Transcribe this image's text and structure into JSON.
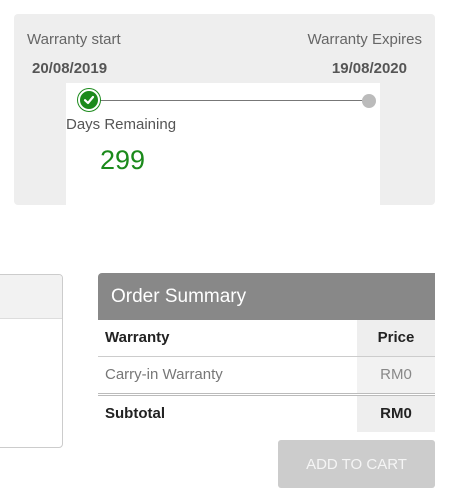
{
  "warranty": {
    "start_label": "Warranty start",
    "start_date": "20/08/2019",
    "expires_label": "Warranty Expires",
    "expires_date": "19/08/2020",
    "days_remaining_label": "Days Remaining",
    "days_remaining_value": "299",
    "accent_color": "#1b8a1b"
  },
  "order_summary": {
    "title": "Order Summary",
    "columns": [
      "Warranty",
      "Price"
    ],
    "rows": [
      {
        "name": "Carry-in Warranty",
        "price": "RM0"
      }
    ],
    "subtotal_label": "Subtotal",
    "subtotal_value": "RM0"
  },
  "actions": {
    "add_to_cart": "ADD TO CART"
  }
}
